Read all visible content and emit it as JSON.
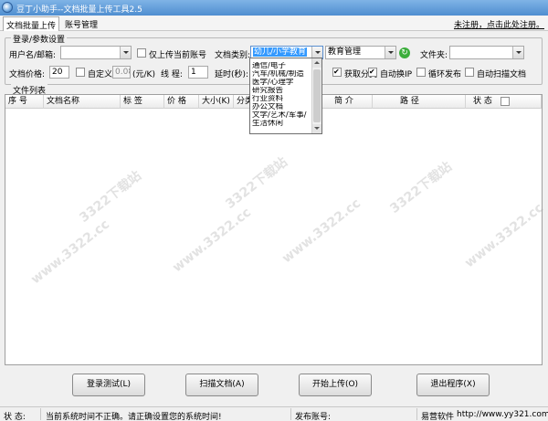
{
  "window": {
    "title": "豆丁小助手--文档批量上传工具2.5"
  },
  "menu": {
    "tabs": [
      "文档批量上传",
      "账号管理"
    ],
    "register_note": "未注册，点击此处注册。"
  },
  "settings": {
    "legend": "登录/参数设置",
    "username_label": "用户名/邮箱:",
    "username_value": "",
    "only_current_account_label": "仅上传当前账号",
    "category_label": "文档类别:",
    "category_value": "幼儿/小学教育",
    "subcategory_value": "教育管理",
    "folder_label": "文件夹:",
    "folder_value": "",
    "price_label": "文档价格:",
    "price_value": "20",
    "custom_label": "自定义",
    "custom_value": "0.08",
    "yuan_label": "(元/K)",
    "threads_label": "线 程:",
    "threads_value": "1",
    "delay_label": "延时(秒):",
    "get_category_label": "获取分类",
    "auto_switch_ip_label": "自动换IP",
    "loop_publish_label": "循环发布",
    "auto_scan_label": "自动扫描文档"
  },
  "category_dropdown": {
    "options": [
      "通信/电子",
      "汽车/机械/制造",
      "医学/心理学",
      "研究报告",
      "行业资料",
      "办公文档",
      "文学/艺术/军事/",
      "生活休闲"
    ]
  },
  "file_list": {
    "legend": "文件列表",
    "columns": [
      "序 号",
      "文档名称",
      "标 签",
      "价 格",
      "大小(K)",
      "分类",
      "简 介",
      "路 径",
      "状 态"
    ],
    "rows": []
  },
  "buttons": {
    "login_test": "登录测试(L)",
    "scan_docs": "扫描文档(A)",
    "start_upload": "开始上传(O)",
    "exit": "退出程序(X)"
  },
  "status": {
    "label": "状 态:",
    "message": "当前系统时间不正确。请正确设置您的系统时间!",
    "publish_account_label": "发布账号:",
    "publish_account_value": "",
    "vendor": "易营软件",
    "url": "http://www.yy321.com"
  },
  "watermark": {
    "texts": [
      "3322下载站",
      "www.3322.cc"
    ]
  },
  "colors": {
    "title_bar": "#4f8ed0",
    "selection": "#3399ff",
    "refresh_icon": "#3cae3c"
  }
}
